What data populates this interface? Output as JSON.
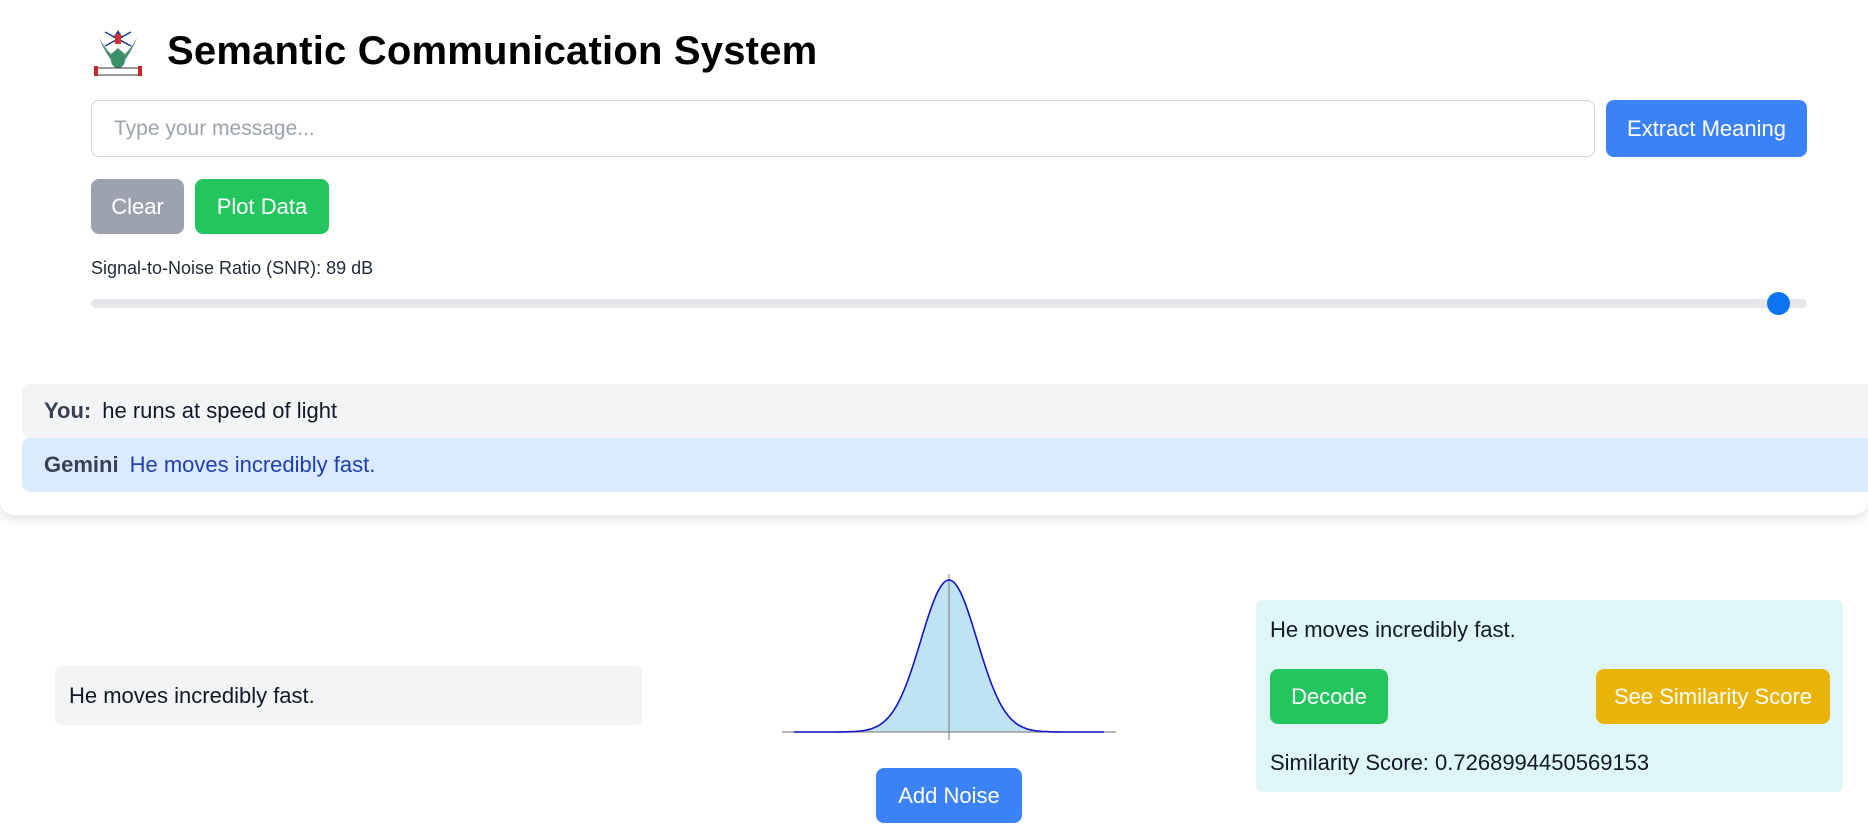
{
  "app": {
    "title": "Semantic Communication System",
    "logo_icon": "emblem-logo-icon"
  },
  "input": {
    "placeholder": "Type your message...",
    "value": ""
  },
  "buttons": {
    "extract": "Extract Meaning",
    "clear": "Clear",
    "plot": "Plot Data",
    "add_noise": "Add Noise",
    "decode": "Decode",
    "similarity": "See Similarity Score"
  },
  "snr": {
    "label": "Signal-to-Noise Ratio (SNR): 89 dB",
    "value_db": 89,
    "level": 0.983
  },
  "chat": [
    {
      "sender": "You:",
      "text": "he runs at speed of light"
    },
    {
      "sender": "Gemini",
      "text": "He moves incredibly fast."
    }
  ],
  "transmitted_text": "He moves incredibly fast.",
  "decoded": {
    "text": "He moves incredibly fast.",
    "similarity_label": "Similarity Score: 0.7268994450569153"
  },
  "colors": {
    "primary": "#3b82f6",
    "success": "#22c55e",
    "warning": "#eab308",
    "neutral": "#9ca3af",
    "curve": "#1414c8",
    "curve_fill": "#bfe3f3"
  }
}
